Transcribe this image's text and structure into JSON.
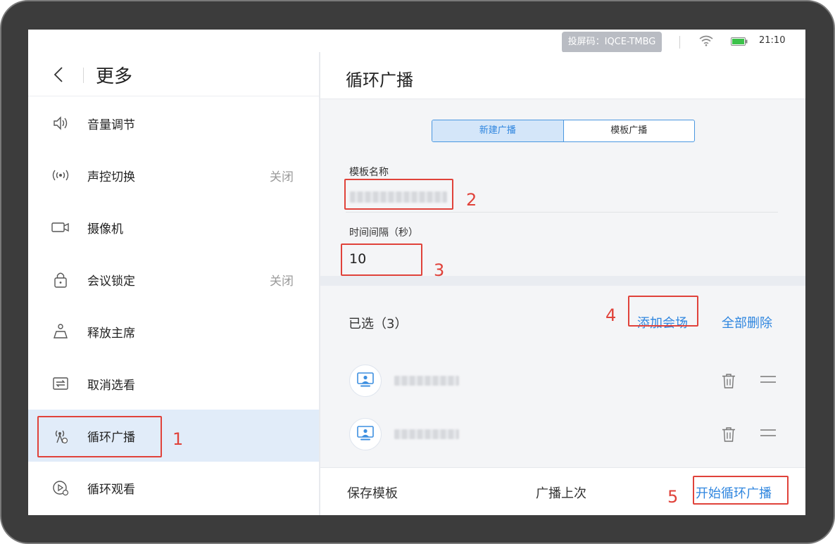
{
  "status_bar": {
    "cast_code": "投屏码：IQCE-TMBG",
    "time": "21:10"
  },
  "left_panel": {
    "title": "更多",
    "items": [
      {
        "label": "音量调节",
        "value": "",
        "icon": "speaker-icon"
      },
      {
        "label": "声控切换",
        "value": "关闭",
        "icon": "voice-wave-icon"
      },
      {
        "label": "摄像机",
        "value": "",
        "icon": "camera-icon"
      },
      {
        "label": "会议锁定",
        "value": "关闭",
        "icon": "lock-icon"
      },
      {
        "label": "释放主席",
        "value": "",
        "icon": "release-chair-icon"
      },
      {
        "label": "取消选看",
        "value": "",
        "icon": "swap-icon"
      },
      {
        "label": "循环广播",
        "value": "",
        "icon": "broadcast-icon",
        "active": true
      },
      {
        "label": "循环观看",
        "value": "",
        "icon": "play-cycle-icon"
      }
    ]
  },
  "right_panel": {
    "title": "循环广播",
    "tabs": [
      "新建广播",
      "模板广播"
    ],
    "active_tab": "新建广播",
    "template_name_label": "模板名称",
    "interval_label": "时间间隔（秒）",
    "interval_value": "10",
    "selected_count": "已选（3）",
    "add_site": "添加会场",
    "delete_all": "全部删除",
    "footer": {
      "save_template": "保存模板",
      "broadcast_previous": "广播上次",
      "start": "开始循环广播"
    }
  },
  "annotations": [
    "1",
    "2",
    "3",
    "4",
    "5"
  ],
  "colors": {
    "accent": "#2f86df",
    "annotation": "#e0423a",
    "active_row": "#e1ecf9"
  }
}
